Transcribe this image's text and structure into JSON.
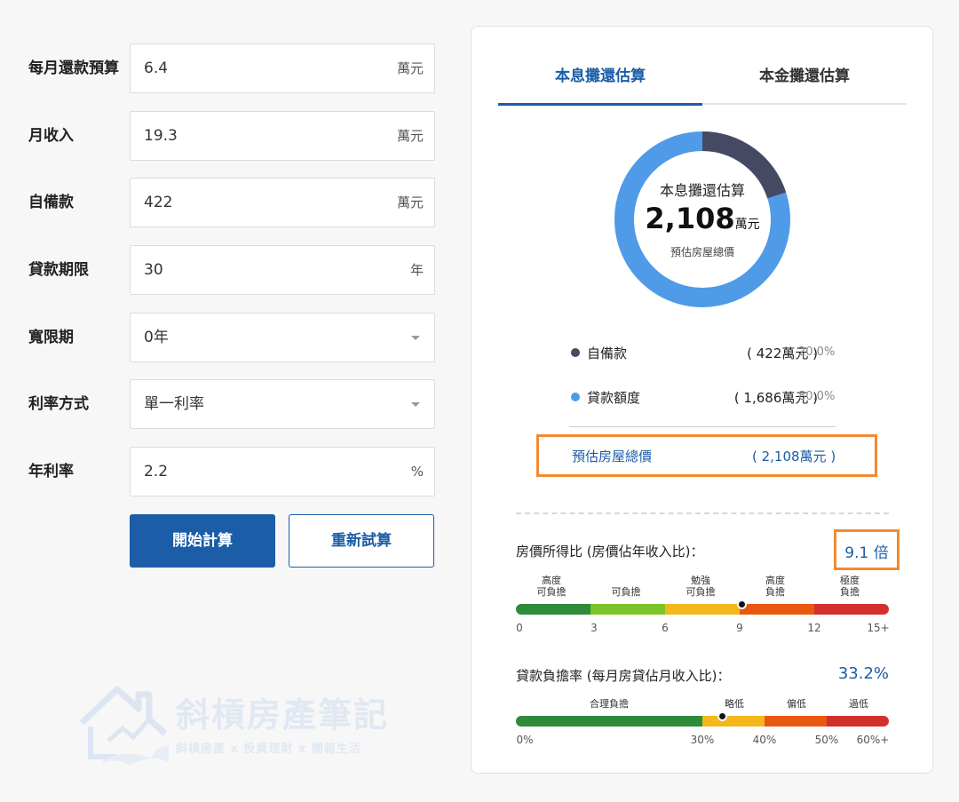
{
  "form": {
    "monthly_budget": {
      "label": "每月還款預算",
      "value": "6.4",
      "unit": "萬元"
    },
    "monthly_income": {
      "label": "月收入",
      "value": "19.3",
      "unit": "萬元"
    },
    "down_payment": {
      "label": "自備款",
      "value": "422",
      "unit": "萬元"
    },
    "loan_term": {
      "label": "貸款期限",
      "value": "30",
      "unit": "年"
    },
    "grace_period": {
      "label": "寬限期",
      "value": "0年"
    },
    "rate_type": {
      "label": "利率方式",
      "value": "單一利率"
    },
    "annual_rate": {
      "label": "年利率",
      "value": "2.2",
      "unit": "%"
    },
    "calculate_label": "開始計算",
    "reset_label": "重新試算"
  },
  "watermark": {
    "title": "斜槓房產筆記",
    "subtitle": "斜槓房產 x 投資理財 x 開箱生活"
  },
  "result": {
    "tabs": [
      {
        "label": "本息攤還估算",
        "active": true
      },
      {
        "label": "本金攤還估算",
        "active": false
      }
    ],
    "donut": {
      "title": "本息攤還估算",
      "value": "2,108",
      "unit": "萬元",
      "subtitle": "預估房屋總價",
      "colors": {
        "down_payment": "#454a62",
        "loan": "#4f9be8"
      }
    },
    "legend": [
      {
        "label": "自備款",
        "amount": "( 422萬元 )",
        "pct": "20.0%",
        "fraction": 0.2,
        "color": "#454a62"
      },
      {
        "label": "貸款額度",
        "amount": "( 1,686萬元 )",
        "pct": "80.0%",
        "fraction": 0.8,
        "color": "#4f9be8"
      }
    ],
    "total": {
      "label": "預估房屋總價",
      "value": "( 2,108萬元 )"
    },
    "price_income": {
      "label": "房價所得比 (房價佔年收入比)：",
      "value": "9.1 倍",
      "indicator": 9.1,
      "scale_max": 15,
      "levels": [
        "高度\n可負擔",
        "可負擔",
        "勉強\n可負擔",
        "高度\n負擔",
        "極度\n負擔"
      ],
      "ticks": [
        "0",
        "3",
        "6",
        "9",
        "12",
        "15+"
      ],
      "colors": [
        "#2e8b3a",
        "#7cc42a",
        "#f4b81c",
        "#e8590f",
        "#d32f2f"
      ]
    },
    "loan_burden": {
      "label": "貸款負擔率 (每月房貸佔月收入比)：",
      "value": "33.2%",
      "indicator": 33.2,
      "scale_max": 60,
      "levels": [
        "合理負擔",
        "略低",
        "偏低",
        "過低"
      ],
      "ticks": [
        "0%",
        "30%",
        "40%",
        "50%",
        "60%+"
      ],
      "colors": [
        "#2e8b3a",
        "#f4b81c",
        "#e8590f",
        "#d32f2f"
      ]
    }
  }
}
